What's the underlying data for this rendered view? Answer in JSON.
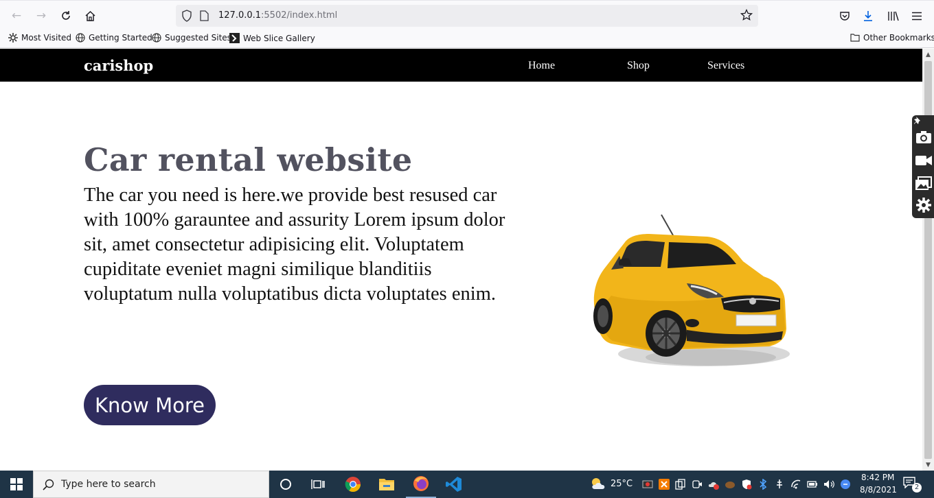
{
  "browser": {
    "url_host": "127.0.0.1",
    "url_rest": ":5502/index.html",
    "bookmarks": [
      "Most Visited",
      "Getting Started",
      "Suggested Sites",
      "Web Slice Gallery"
    ],
    "other_bookmarks": "Other Bookmarks"
  },
  "page": {
    "brand": "carishop",
    "nav": [
      "Home",
      "Shop",
      "Services"
    ],
    "hero_title": "Car rental website",
    "hero_text": "The car you need is here.we provide best resused car with 100% garauntee and assurity Lorem ipsum dolor sit, amet consectetur adipisicing elit. Voluptatem cupiditate eveniet magni similique blanditiis voluptatum nulla voluptatibus dicta voluptates enim.",
    "cta_label": "Know More",
    "colors": {
      "navbar": "#000000",
      "title": "#52525f",
      "button": "#2f2c5e",
      "car": "#f0b010"
    }
  },
  "taskbar": {
    "search_placeholder": "Type here to search",
    "temperature": "25°C",
    "time": "8:42 PM",
    "date": "8/8/2021",
    "notifications": "2"
  }
}
